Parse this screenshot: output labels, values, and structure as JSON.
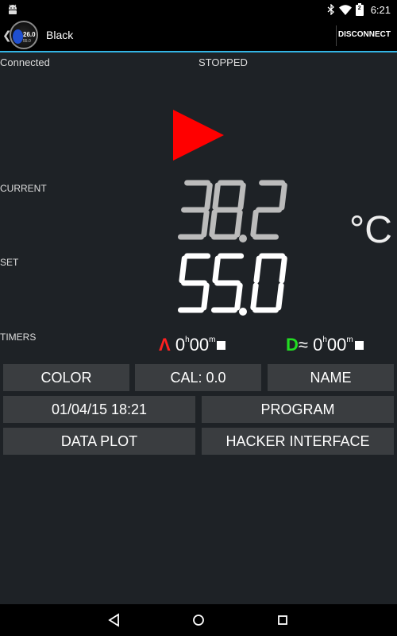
{
  "status_bar": {
    "time": "6:21",
    "battery_level": "2",
    "icons": [
      "android-icon",
      "bluetooth-icon",
      "wifi-icon",
      "battery-icon"
    ]
  },
  "action_bar": {
    "title": "Black",
    "disconnect_label": "DISCONNECT",
    "app_icon": {
      "reading": "26.0",
      "sub": "55.0"
    },
    "accent": "#33b5e5"
  },
  "status": {
    "connection": "Connected",
    "run_state": "STOPPED"
  },
  "play_icon": {
    "color": "#ff0000"
  },
  "readings": {
    "current_label": "CURRENT",
    "current_value": "38.2",
    "current_color": "#bbbbbb",
    "set_label": "SET",
    "set_value": "55.0",
    "set_color": "#ffffff",
    "unit": "°C"
  },
  "timers": {
    "label": "TIMERS",
    "up": {
      "symbol": "Λ",
      "color": "#ff2020",
      "hours": "0",
      "h_unit": "h",
      "minutes": "00",
      "m_unit": "m"
    },
    "down": {
      "symbol": "D",
      "color": "#22dd22",
      "approx": "≈",
      "hours": "0",
      "h_unit": "h",
      "minutes": "00",
      "m_unit": "m"
    }
  },
  "buttons": {
    "color": "COLOR",
    "cal": "CAL: 0.0",
    "name": "NAME",
    "datetime": "01/04/15 18:21",
    "program": "PROGRAM",
    "data_plot": "DATA PLOT",
    "hacker": "HACKER INTERFACE"
  },
  "nav_bar": {
    "icons": [
      "back-icon",
      "home-icon",
      "recents-icon"
    ]
  }
}
